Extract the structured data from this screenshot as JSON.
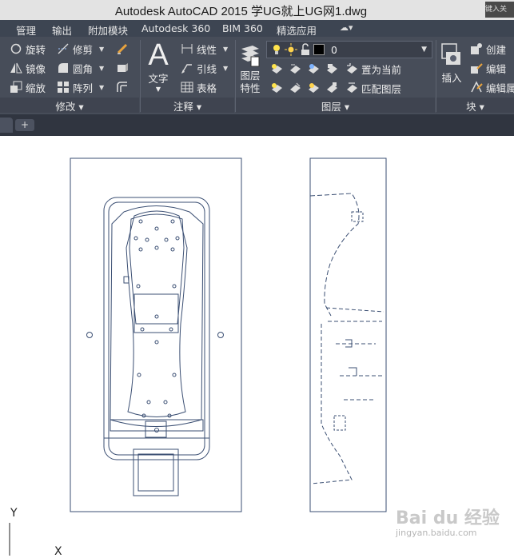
{
  "window": {
    "title": "Autodesk AutoCAD 2015    学UG就上UG网1.dwg",
    "search_placeholder": "键入关"
  },
  "menu": {
    "tabs": [
      "管理",
      "输出",
      "附加模块",
      "Autodesk 360",
      "BIM 360",
      "精选应用"
    ]
  },
  "ribbon": {
    "modify": {
      "label": "修改",
      "items": {
        "rotate": "旋转",
        "trim": "修剪",
        "mirror": "镜像",
        "fillet": "圆角",
        "scale": "缩放",
        "array": "阵列"
      }
    },
    "annotation": {
      "label": "注释",
      "text": "文字",
      "items": {
        "linear": "线性",
        "leader": "引线",
        "table": "表格"
      }
    },
    "layers": {
      "label": "图层",
      "properties": "图层特性",
      "current_layer": "0",
      "set_current": "置为当前",
      "match_layer": "匹配图层"
    },
    "block": {
      "label": "块",
      "insert": "插入",
      "create": "创建",
      "edit": "编辑",
      "edit_attr": "编辑属"
    }
  },
  "drawing": {
    "axis_y": "Y",
    "axis_x": "X"
  },
  "watermark": {
    "brand": "Bai du 经验",
    "url": "jingyan.baidu.com"
  },
  "colors": {
    "accent_line": "#3b4f73",
    "ribbon_bg": "#474d59",
    "menu_bg": "#3d4552"
  }
}
